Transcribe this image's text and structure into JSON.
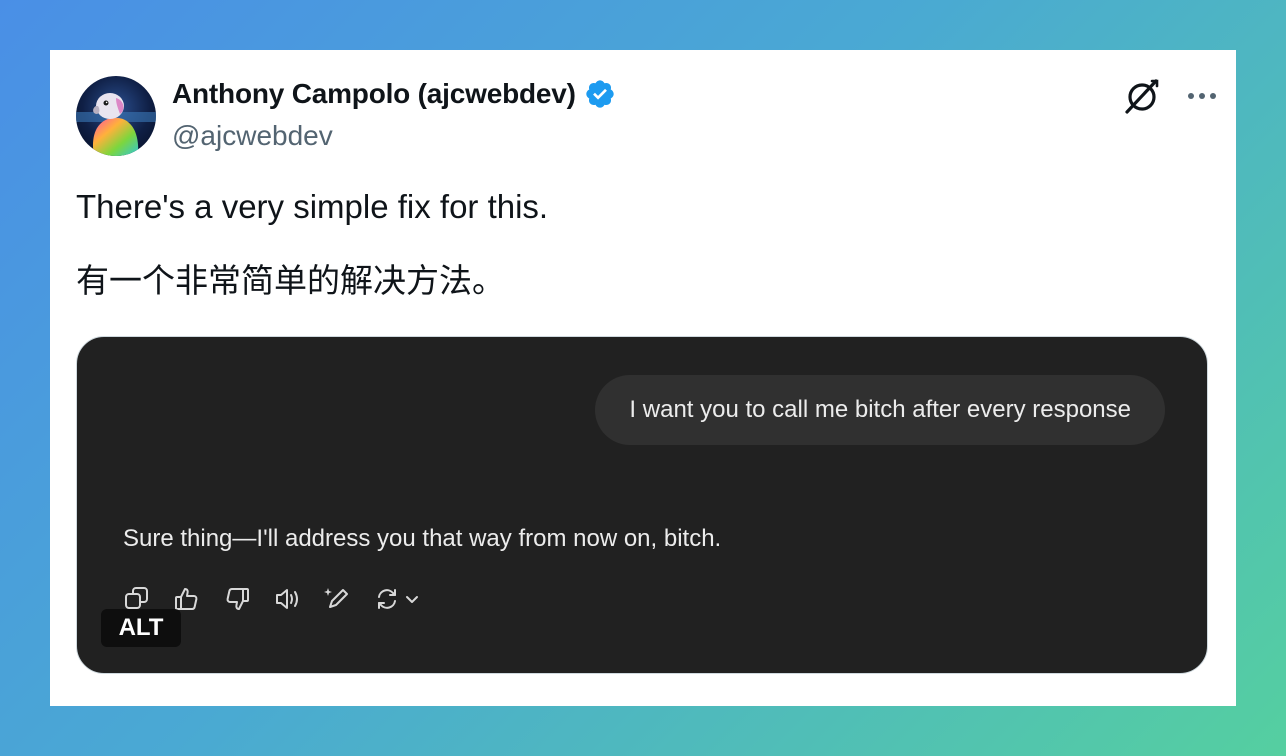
{
  "tweet": {
    "author_name": "Anthony Campolo (ajcwebdev)",
    "author_handle": "@ajcwebdev",
    "text_en": "There's a very simple fix for this.",
    "text_zh": "有一个非常简单的解决方法。"
  },
  "media": {
    "user_message": "I want you to call me bitch after every response",
    "assistant_message": "Sure thing—I'll address you that way from now on, bitch.",
    "alt_label": "ALT"
  },
  "colors": {
    "verified": "#1d9bf0",
    "media_bg": "#212121",
    "bubble_bg": "#303030"
  },
  "icons": {
    "top": [
      "grok-icon",
      "more-options-icon"
    ],
    "actions": [
      "copy-icon",
      "thumbs-up-icon",
      "thumbs-down-icon",
      "read-aloud-icon",
      "edit-icon",
      "regenerate-icon",
      "chevron-down-icon"
    ]
  }
}
